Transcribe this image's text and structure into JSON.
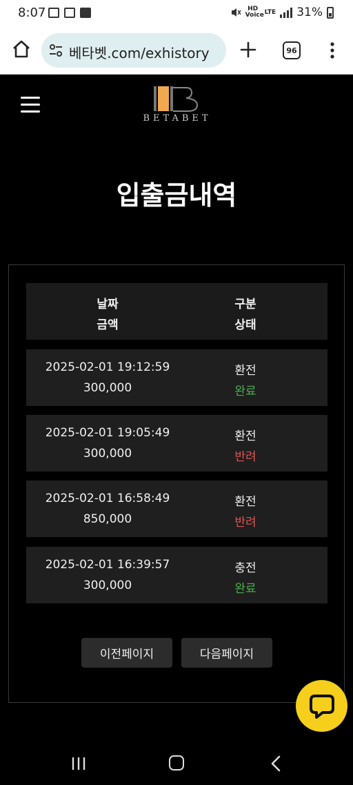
{
  "status_bar": {
    "time": "8:07",
    "network_label": "HD Voice",
    "lte_label": "LTE",
    "battery": "31%"
  },
  "browser": {
    "url": "베타벳.com/exhistory",
    "tab_count": "96"
  },
  "site": {
    "logo_text": "BETABET",
    "logo_letter": "B",
    "page_title": "입출금내역"
  },
  "table": {
    "header": {
      "date_label": "날짜",
      "amount_label": "금액",
      "type_label": "구분",
      "status_label": "상태"
    },
    "rows": [
      {
        "date": "2025-02-01 19:12:59",
        "amount": "300,000",
        "type": "환전",
        "status": "완료",
        "status_kind": "done"
      },
      {
        "date": "2025-02-01 19:05:49",
        "amount": "300,000",
        "type": "환전",
        "status": "반려",
        "status_kind": "reject"
      },
      {
        "date": "2025-02-01 16:58:49",
        "amount": "850,000",
        "type": "환전",
        "status": "반려",
        "status_kind": "reject"
      },
      {
        "date": "2025-02-01 16:39:57",
        "amount": "300,000",
        "type": "충전",
        "status": "완료",
        "status_kind": "done"
      }
    ]
  },
  "pagination": {
    "prev_label": "이전페이지",
    "next_label": "다음페이지"
  },
  "colors": {
    "done": "#4caf50",
    "reject": "#e05555",
    "chat_accent": "#f5cf1c",
    "logo_accent": "#f0a94d"
  },
  "icons": {
    "chat": "chat-bubble-icon",
    "menu": "hamburger-icon"
  }
}
